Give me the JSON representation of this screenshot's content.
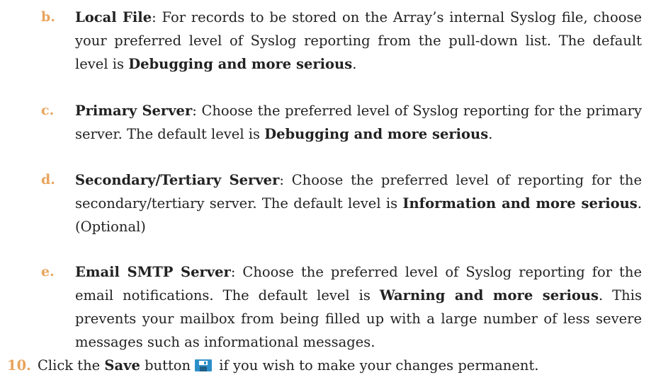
{
  "colors": {
    "marker": "#e8a45c",
    "text": "#222222",
    "save_icon_bg": "#2d8fc9"
  },
  "sub_items": [
    {
      "marker": "b.",
      "term": "Local File",
      "text_a": ": For records to be stored on the Array’s internal Syslog file, choose your preferred level of Syslog reporting from the pull-down list. The default level is ",
      "bold_a": "Debugging and more serious",
      "text_b": "."
    },
    {
      "marker": "c.",
      "term": "Primary Server",
      "text_a": ": Choose the preferred level of Syslog reporting for the primary server. The default level is ",
      "bold_a": "Debugging and more serious",
      "text_b": "."
    },
    {
      "marker": "d.",
      "term": "Secondary/Tertiary Server",
      "text_a": ": Choose the preferred level of reporting for the secondary/tertiary server. The default level is ",
      "bold_a": "Information and more serious",
      "text_b": ". (Optional)"
    },
    {
      "marker": "e.",
      "term": "Email SMTP Server",
      "text_a": ": Choose the preferred level of Syslog reporting for the email notifications. The default level is ",
      "bold_a": "Warning and more serious",
      "text_b": ". This prevents your mailbox from being filled up with a large number of less severe messages such as informational messages."
    }
  ],
  "step": {
    "number": "10.",
    "text_before": "Click the ",
    "bold": "Save",
    "text_mid": " button",
    "text_after": " if you wish to make your changes permanent.",
    "icon": "save-icon"
  }
}
